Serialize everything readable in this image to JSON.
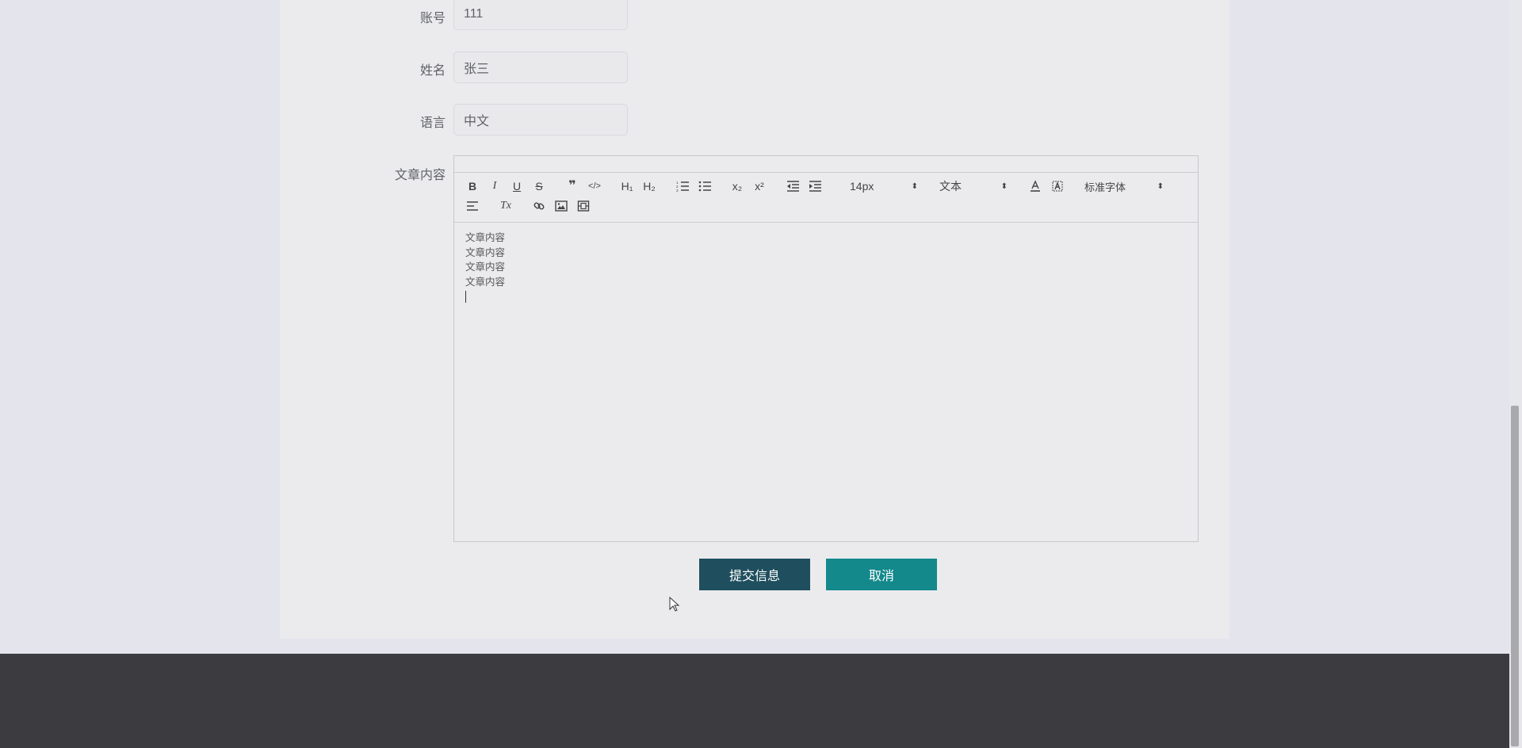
{
  "form": {
    "account": {
      "label": "账号",
      "value": "111"
    },
    "name": {
      "label": "姓名",
      "value": "张三"
    },
    "language": {
      "label": "语言",
      "value": "中文"
    },
    "content": {
      "label": "文章内容"
    }
  },
  "editor": {
    "toolbar": {
      "bold": "B",
      "italic": "I",
      "underline": "U",
      "strike": "S",
      "blockquote": "❞",
      "code_block": "</>",
      "h1": "H₁",
      "h2": "H₂",
      "subscript": "x₂",
      "superscript": "x²",
      "clean": "Tx",
      "size_picker": "14px",
      "header_picker": "文本",
      "font_picker": "标准字体"
    },
    "lines": [
      "文章内容",
      "文章内容",
      "文章内容",
      "文章内容"
    ]
  },
  "actions": {
    "submit": "提交信息",
    "cancel": "取消"
  },
  "colors": {
    "submit_bg": "#1f4f5e",
    "cancel_bg": "#13898c",
    "footer_bg": "#3c3b3f"
  }
}
